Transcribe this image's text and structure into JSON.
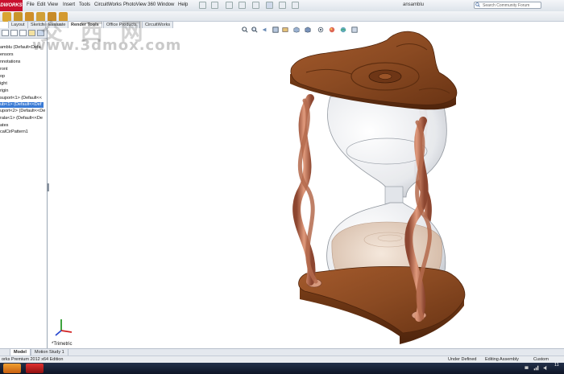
{
  "app": {
    "logo_text": "DWORKS",
    "document_title": "ansamblu",
    "search_placeholder": "Search Community Forum"
  },
  "menu": {
    "items": [
      "File",
      "Edit",
      "View",
      "Insert",
      "Tools",
      "CircuitWorks",
      "PhotoView 360",
      "Window",
      "Help"
    ]
  },
  "command_tabs": {
    "items": [
      "Layout",
      "Sketch",
      "Evaluate",
      "Render Tools",
      "Office Products",
      "CircuitWorks"
    ],
    "active": "Render Tools"
  },
  "tree": {
    "items": [
      {
        "label": "amblu  (Default<Defa",
        "selected": false
      },
      {
        "label": "ensors",
        "selected": false
      },
      {
        "label": "nnotations",
        "selected": false
      },
      {
        "label": "ront",
        "selected": false
      },
      {
        "label": "op",
        "selected": false
      },
      {
        "label": "ight",
        "selected": false
      },
      {
        "label": "rigin",
        "selected": false
      },
      {
        "label": "suport<1> (Default<<",
        "selected": false
      },
      {
        "label": "ub<1> (Default<<Def",
        "selected": true
      },
      {
        "label": "uport<2> (Default<<De",
        "selected": false
      },
      {
        "label": "rala<1> (Default<<De",
        "selected": false
      },
      {
        "label": "ates",
        "selected": false
      },
      {
        "label": "calCirPattern1",
        "selected": false
      }
    ]
  },
  "viewport": {
    "view_name": "*Trimetric"
  },
  "bottom_tabs": {
    "items": [
      "Model",
      "Motion Study 1"
    ],
    "active": "Model"
  },
  "status": {
    "edition": "orks Premium 2012 x64 Edition",
    "state": "Under Defined",
    "mode": "Editing Assembly",
    "units": "Custom"
  },
  "taskbar": {
    "clock": "11"
  },
  "watermark": {
    "text": "www.3dmox.com",
    "glyphs": "交 西 网"
  },
  "colors": {
    "wood": "#8a4a22",
    "wood_dark": "#5e2e10",
    "copper": "#c8785a",
    "glass": "#e8eaee",
    "sand": "#e4d0c0",
    "selection": "#3a7bd5",
    "brand_red": "#c8102e"
  }
}
